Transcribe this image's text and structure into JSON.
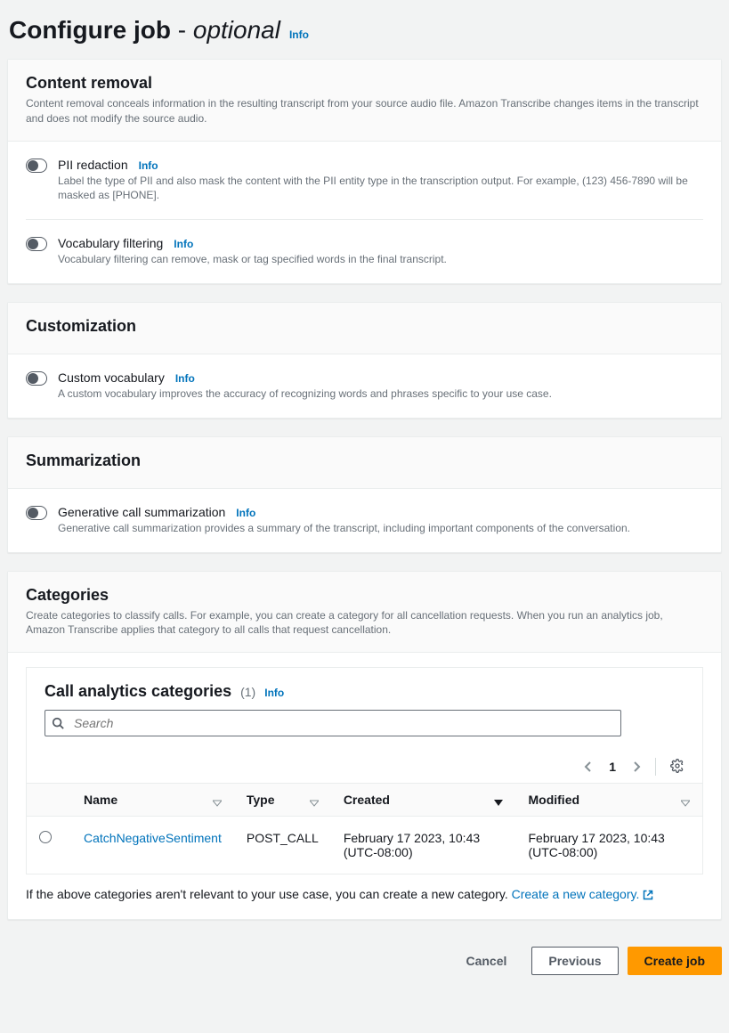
{
  "page": {
    "title_main": "Configure job",
    "title_sep": "-",
    "title_optional": "optional",
    "info": "Info"
  },
  "panels": {
    "content_removal": {
      "title": "Content removal",
      "desc": "Content removal conceals information in the resulting transcript from your source audio file. Amazon Transcribe changes items in the transcript and does not modify the source audio.",
      "options": [
        {
          "label": "PII redaction",
          "info": "Info",
          "desc": "Label the type of PII and also mask the content with the PII entity type in the transcription output. For example, (123) 456-7890 will be masked as [PHONE]."
        },
        {
          "label": "Vocabulary filtering",
          "info": "Info",
          "desc": "Vocabulary filtering can remove, mask or tag specified words in the final transcript."
        }
      ]
    },
    "customization": {
      "title": "Customization",
      "options": [
        {
          "label": "Custom vocabulary",
          "info": "Info",
          "desc": "A custom vocabulary improves the accuracy of recognizing words and phrases specific to your use case."
        }
      ]
    },
    "summarization": {
      "title": "Summarization",
      "options": [
        {
          "label": "Generative call summarization",
          "info": "Info",
          "desc": "Generative call summarization provides a summary of the transcript, including important components of the conversation."
        }
      ]
    },
    "categories": {
      "title": "Categories",
      "desc": "Create categories to classify calls. For example, you can create a category for all cancellation requests. When you run an analytics job, Amazon Transcribe applies that category to all calls that request cancellation.",
      "table": {
        "title": "Call analytics categories",
        "count": "(1)",
        "info": "Info",
        "search_placeholder": "Search",
        "page_number": "1",
        "columns": {
          "name": "Name",
          "type": "Type",
          "created": "Created",
          "modified": "Modified"
        },
        "rows": [
          {
            "name": "CatchNegativeSentiment",
            "type": "POST_CALL",
            "created": "February 17 2023, 10:43 (UTC-08:00)",
            "modified": "February 17 2023, 10:43 (UTC-08:00)"
          }
        ]
      },
      "footer_text": "If the above categories aren't relevant to your use case, you can create a new category. ",
      "create_link": "Create a new category."
    }
  },
  "footer": {
    "cancel": "Cancel",
    "previous": "Previous",
    "create": "Create job"
  }
}
